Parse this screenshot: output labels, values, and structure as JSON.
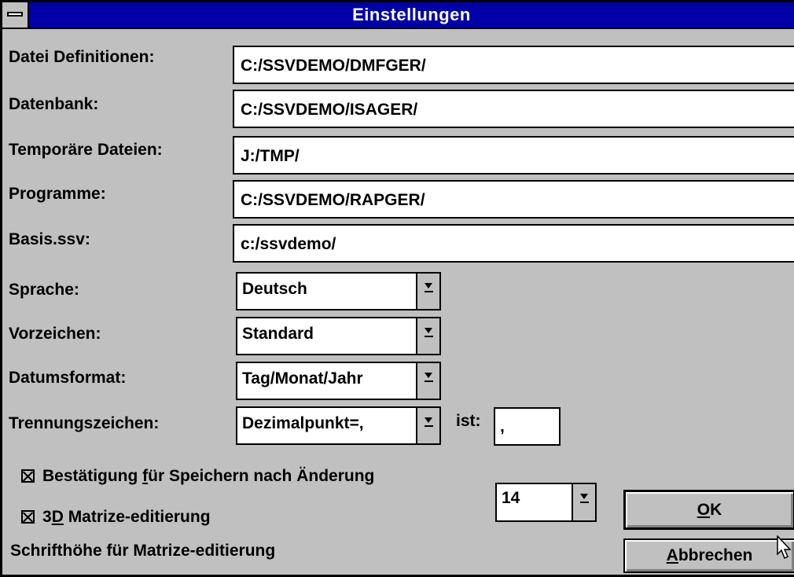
{
  "window": {
    "title": "Einstellungen"
  },
  "paths": [
    {
      "label": "Datei Definitionen:",
      "value": "C:/SSVDEMO/DMFGER/"
    },
    {
      "label": "Datenbank:",
      "value": "C:/SSVDEMO/ISAGER/"
    },
    {
      "label": "Temporäre Dateien:",
      "value": "J:/TMP/"
    },
    {
      "label": "Programme:",
      "value": "C:/SSVDEMO/RAPGER/"
    },
    {
      "label": "Basis.ssv:",
      "value": "c:/ssvdemo/"
    }
  ],
  "selects": [
    {
      "label": "Sprache:",
      "value": "Deutsch"
    },
    {
      "label": "Vorzeichen:",
      "value": "Standard"
    },
    {
      "label": "Datumsformat:",
      "value": "Tag/Monat/Jahr"
    },
    {
      "label": "Trennungszeichen:",
      "value": "Dezimalpunkt=,"
    }
  ],
  "separator": {
    "ist_label": "ist:",
    "ist_value": ","
  },
  "checkboxes": {
    "confirm_prefix": "Bestätigung ",
    "confirm_accel": "f",
    "confirm_suffix": "ür Speichern nach Änderung",
    "confirm_checked": true,
    "matrix_prefix": "3",
    "matrix_accel": "D",
    "matrix_suffix": " Matrize-editierung",
    "matrix_checked": true
  },
  "font_height": {
    "label": "Schrifthöhe für Matrize-editierung",
    "value": "14"
  },
  "buttons": {
    "ok_accel": "O",
    "ok_rest": "K",
    "cancel_accel": "A",
    "cancel_rest": "bbrechen"
  }
}
